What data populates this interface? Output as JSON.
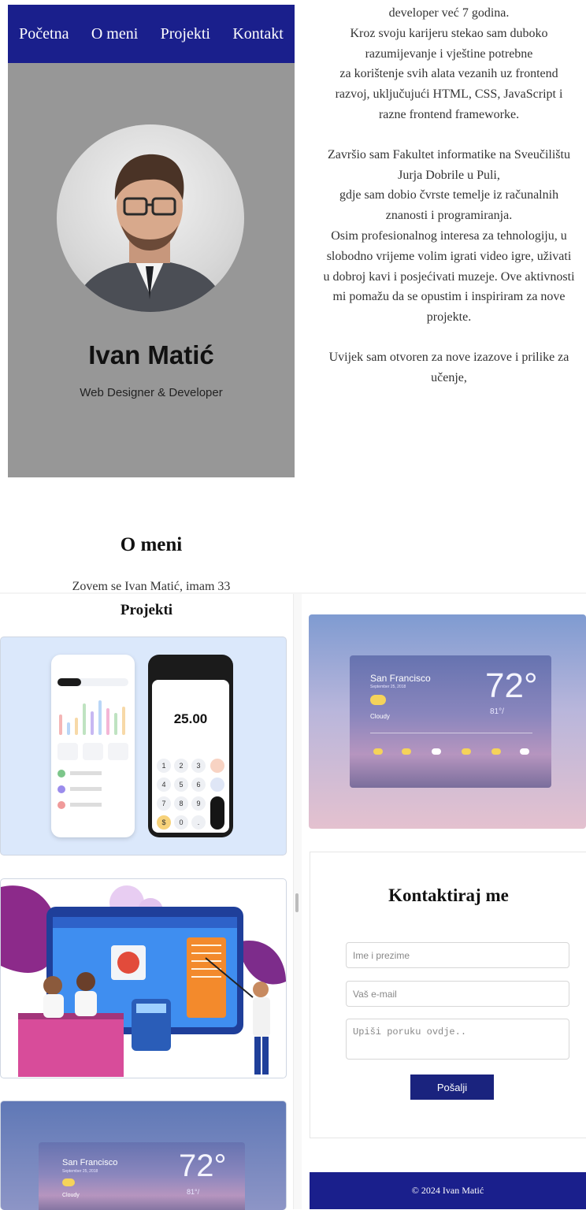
{
  "nav": {
    "items": [
      "Početna",
      "O meni",
      "Projekti",
      "Kontakt"
    ]
  },
  "hero": {
    "name": "Ivan Matić",
    "role": "Web Designer & Developer"
  },
  "about": {
    "title": "O meni",
    "intro_partial": "Zovem se Ivan Matić, imam 33",
    "paragraphs": [
      "developer već 7 godina.\nKroz svoju karijeru stekao sam duboko razumijevanje i vještine potrebne\nza korištenje svih alata vezanih uz frontend razvoj, uključujući HTML, CSS, JavaScript i razne frontend frameworke.",
      "Završio sam Fakultet informatike na Sveučilištu Jurja Dobrile u Puli,\ngdje sam dobio čvrste temelje iz računalnih znanosti i programiranja.\nOsim profesionalnog interesa za tehnologiju, u slobodno vrijeme volim igrati video igre, uživati u dobroj kavi i posjećivati muzeje. Ove aktivnosti mi pomažu da se opustim i inspiriram za nove projekte.",
      "Uvijek sam otvoren za nove izazove i prilike za učenje,"
    ]
  },
  "projects": {
    "title": "Projekti",
    "calc_amount": "25.00",
    "calc_keys": [
      "1",
      "2",
      "3",
      "4",
      "5",
      "6",
      "7",
      "8",
      "9",
      "$",
      "0",
      "."
    ]
  },
  "weather": {
    "city": "San Francisco",
    "date": "September 25, 2018",
    "temp": "72°",
    "hi_lo": "81°/",
    "condition": "Cloudy"
  },
  "contact": {
    "title": "Kontaktiraj me",
    "name_placeholder": "Ime i prezime",
    "email_placeholder": "Vaš e-mail",
    "message_placeholder": "Upiši poruku ovdje..",
    "submit": "Pošalji"
  },
  "footer": {
    "text": "© 2024 Ivan Matić"
  },
  "colors": {
    "nav_bg": "#1a1f8c",
    "hero_bg": "#979797",
    "button": "#1a237e"
  }
}
